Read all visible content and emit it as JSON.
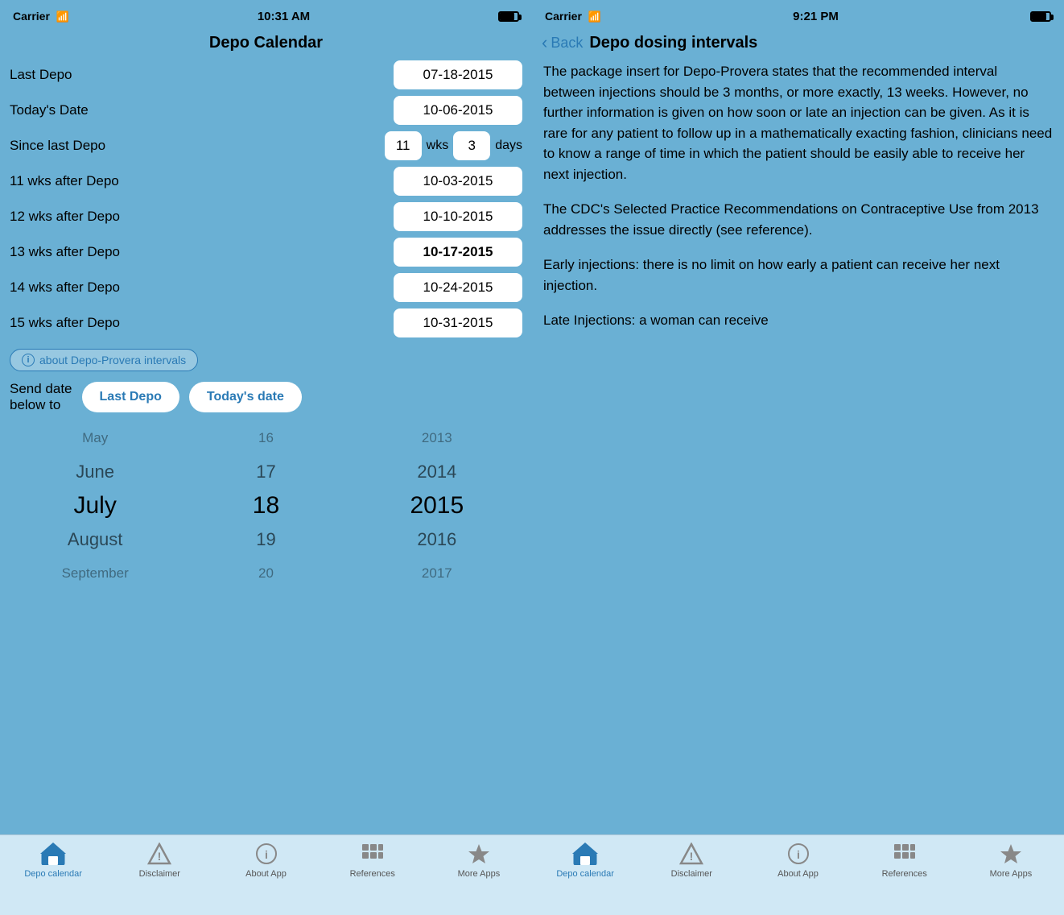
{
  "left_phone": {
    "status_bar": {
      "carrier": "Carrier",
      "time": "10:31 AM"
    },
    "title": "Depo Calendar",
    "rows": [
      {
        "label": "Last Depo",
        "value": "07-18-2015",
        "bold": false
      },
      {
        "label": "Today's Date",
        "value": "10-06-2015",
        "bold": false
      },
      {
        "label": "Since last Depo",
        "wks": "11",
        "days": "3",
        "special": true
      },
      {
        "label": "11 wks after Depo",
        "value": "10-03-2015",
        "bold": false
      },
      {
        "label": "12 wks after Depo",
        "value": "10-10-2015",
        "bold": false
      },
      {
        "label": "13 wks after Depo",
        "value": "10-17-2015",
        "bold": true
      },
      {
        "label": "14 wks after Depo",
        "value": "10-24-2015",
        "bold": false
      },
      {
        "label": "15 wks after Depo",
        "value": "10-31-2015",
        "bold": false
      }
    ],
    "info_button": "about Depo-Provera intervals",
    "send_label": "Send date\nbelow to",
    "send_btn1": "Last Depo",
    "send_btn2": "Today's date",
    "picker": {
      "months": [
        "May",
        "June",
        "July",
        "August",
        "September"
      ],
      "days": [
        "16",
        "17",
        "18",
        "19",
        "20"
      ],
      "years": [
        "2013",
        "2014",
        "2015",
        "2016",
        "2017"
      ]
    },
    "tabs": [
      {
        "label": "Depo calendar",
        "icon": "home",
        "active": true
      },
      {
        "label": "Disclaimer",
        "icon": "warning",
        "active": false
      },
      {
        "label": "About App",
        "icon": "info",
        "active": false
      },
      {
        "label": "References",
        "icon": "refs",
        "active": false
      },
      {
        "label": "More Apps",
        "icon": "star",
        "active": false
      }
    ]
  },
  "right_phone": {
    "status_bar": {
      "carrier": "Carrier",
      "time": "9:21 PM"
    },
    "back_label": "Back",
    "title": "Depo dosing intervals",
    "paragraphs": [
      "The package insert for Depo-Provera states that the recommended interval between injections should be 3 months, or more exactly, 13 weeks. However, no further information is given on how soon or late an injection can be given.  As it is rare for any patient to follow up in a mathematically exacting fashion, clinicians need to know a range of time in which the patient should be easily able to receive her next injection.",
      "The CDC's Selected Practice Recommendations on Contraceptive Use from 2013 addresses the issue directly (see reference).",
      "Early injections:  there is no limit on how early a patient can receive her next injection.",
      "Late Injections:  a woman can receive"
    ],
    "tabs": [
      {
        "label": "Depo calendar",
        "icon": "home",
        "active": true
      },
      {
        "label": "Disclaimer",
        "icon": "warning",
        "active": false
      },
      {
        "label": "About App",
        "icon": "info",
        "active": false
      },
      {
        "label": "References",
        "icon": "refs",
        "active": false
      },
      {
        "label": "More Apps",
        "icon": "star",
        "active": false
      }
    ]
  }
}
